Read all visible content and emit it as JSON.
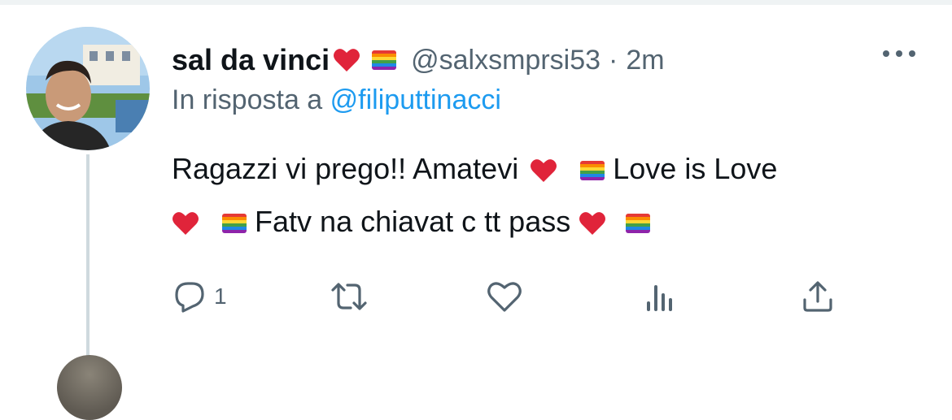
{
  "tweet": {
    "display_name": "sal da vinci",
    "handle": "@salxsmprsi53",
    "separator": "·",
    "time": "2m",
    "reply_prefix": "In risposta a ",
    "reply_mention": "@filiputtinacci",
    "text_line1_a": "Ragazzi vi prego!! Amatevi",
    "text_line1_b": " Love is Love",
    "text_line2_a": " Fatv na chiavat c tt pass",
    "reply_count": "1"
  },
  "icons": {
    "more": "more-icon",
    "reply": "reply-icon",
    "retweet": "retweet-icon",
    "like": "like-icon",
    "analytics": "analytics-icon",
    "share": "share-icon",
    "heart_emoji": "red-heart-emoji",
    "flag_emoji": "rainbow-flag-emoji"
  },
  "colors": {
    "text": "#0f1419",
    "secondary": "#536471",
    "link": "#1d9bf0",
    "heart": "#e0243a",
    "thread_line": "#cfd9de"
  }
}
